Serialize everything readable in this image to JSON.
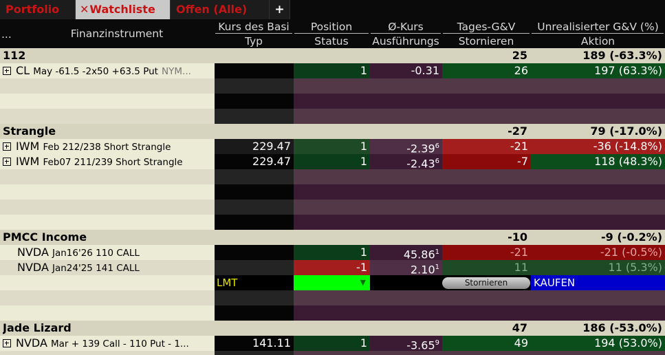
{
  "tabs": [
    {
      "label": "Portfolio",
      "active": false
    },
    {
      "label": "Watchliste",
      "active": true,
      "close_icon": "close-icon"
    },
    {
      "label": "Offen (Alle)",
      "active": false
    },
    {
      "label": "+",
      "active": false
    }
  ],
  "header": {
    "menu": "...",
    "instrument": "Finanzinstrument",
    "kurs": "Kurs des Basi",
    "typ": "Typ",
    "position": "Position",
    "status": "Status",
    "okurs": "Ø-Kurs",
    "ausfuehrung": "Ausführungs",
    "tages": "Tages-G&V",
    "stornieren": "Stornieren",
    "unreal": "Unrealisierter G&V (%)",
    "aktion": "Aktion"
  },
  "groups": {
    "g112": {
      "name": "112",
      "tages": "25",
      "unreal": "189 (-63.3%)"
    },
    "strangle": {
      "name": "Strangle",
      "tages": "-27",
      "unreal": "79 (-17.0%)"
    },
    "pmcc": {
      "name": "PMCC Income",
      "tages": "-10",
      "unreal": "-9 (-0.2%)"
    },
    "jade": {
      "name": "Jade Lizard",
      "tages": "47",
      "unreal": "186 (-53.0%)"
    }
  },
  "rows": {
    "cl": {
      "sym": "CL",
      "desc": "May -61.5 -2x50 +63.5 Put",
      "exch": "NYM...",
      "kurs": "",
      "pos": "1",
      "avg": "-0.31",
      "avg_sup": "",
      "tages": "26",
      "unreal": "197 (63.3%)"
    },
    "iwm1": {
      "sym": "IWM",
      "desc": "Feb 212/238 Short Strangle",
      "kurs": "229.47",
      "pos": "1",
      "avg": "-2.39",
      "avg_sup": "6",
      "tages": "-21",
      "unreal": "-36 (-14.8%)"
    },
    "iwm2": {
      "sym": "IWM",
      "desc": "Feb07 211/239 Short Strangle",
      "kurs": "229.47",
      "pos": "1",
      "avg": "-2.43",
      "avg_sup": "6",
      "tages": "-7",
      "unreal": "118 (48.3%)"
    },
    "nvda1": {
      "sym": "NVDA",
      "desc": "Jan16'26 110 CALL",
      "pos": "1",
      "avg": "45.86",
      "avg_sup": "1",
      "tages": "-21",
      "unreal": "-21 (-0.5%)"
    },
    "nvda2": {
      "sym": "NVDA",
      "desc": "Jan24'25 141 CALL",
      "pos": "-1",
      "avg": "2.10",
      "avg_sup": "1",
      "tages": "11",
      "unreal": "11 (5.3%)"
    },
    "order": {
      "typ": "LMT",
      "status_icon": "dropdown-triangle-icon",
      "cancel": "Stornieren",
      "action": "KAUFEN"
    },
    "nvda3": {
      "sym": "NVDA",
      "desc": "Mar + 139 Call - 110 Put - 1...",
      "kurs": "141.11",
      "pos": "1",
      "avg": "-3.65",
      "avg_sup": "9",
      "tages": "49",
      "unreal": "194 (53.0%)"
    }
  },
  "colors": {
    "accent_red": "#c81414",
    "green_active": "#00ff00",
    "buy_blue": "#0000cc"
  }
}
